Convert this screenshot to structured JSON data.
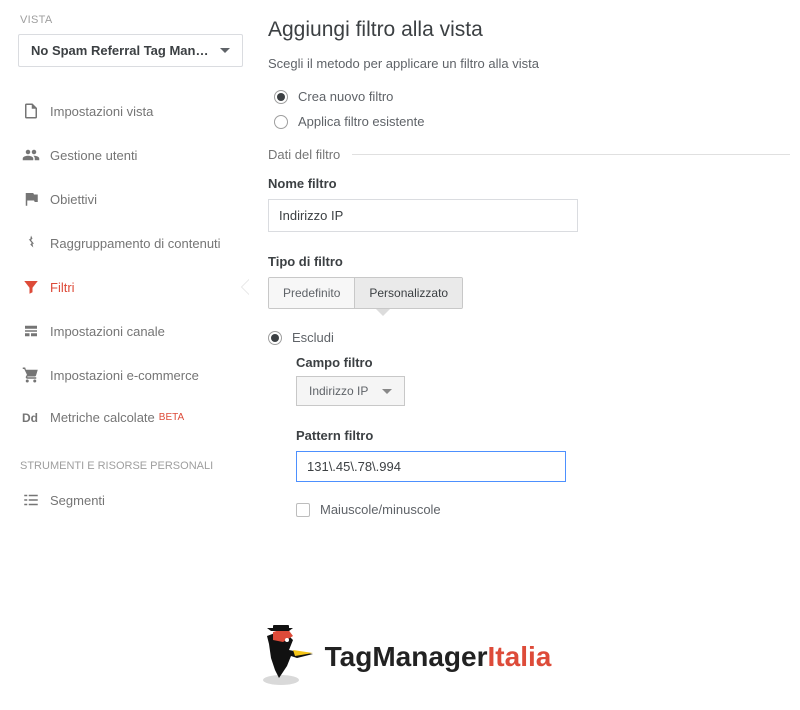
{
  "sidebar": {
    "section_label": "VISTA",
    "view_name": "No Spam Referral Tag Mana…",
    "items": [
      {
        "label": "Impostazioni vista"
      },
      {
        "label": "Gestione utenti"
      },
      {
        "label": "Obiettivi"
      },
      {
        "label": "Raggruppamento di contenuti"
      },
      {
        "label": "Filtri"
      },
      {
        "label": "Impostazioni canale"
      },
      {
        "label": "Impostazioni e-commerce"
      },
      {
        "label": "Metriche calcolate",
        "badge": "BETA"
      }
    ],
    "tools_label": "STRUMENTI E RISORSE PERSONALI",
    "tools": [
      {
        "label": "Segmenti"
      }
    ]
  },
  "main": {
    "title": "Aggiungi filtro alla vista",
    "subtitle": "Scegli il metodo per applicare un filtro alla vista",
    "method_options": {
      "create_new": "Crea nuovo filtro",
      "apply_existing": "Applica filtro esistente"
    },
    "filter_data_legend": "Dati del filtro",
    "name_label": "Nome filtro",
    "name_value": "Indirizzo IP",
    "type_label": "Tipo di filtro",
    "type_options": {
      "predefined": "Predefinito",
      "custom": "Personalizzato"
    },
    "exclude": {
      "label": "Escludi",
      "field_label": "Campo filtro",
      "field_value": "Indirizzo IP",
      "pattern_label": "Pattern filtro",
      "pattern_value": "131\\.45\\.78\\.994",
      "case_label": "Maiuscole/minuscole"
    }
  },
  "footer": {
    "brand_main": "TagManager",
    "brand_accent": "Italia"
  }
}
